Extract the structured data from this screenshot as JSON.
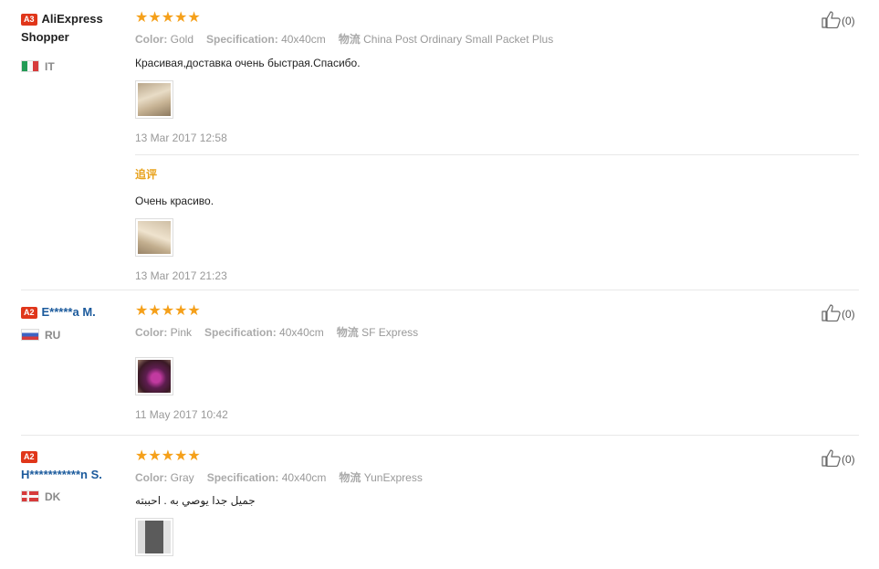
{
  "reviews": [
    {
      "badge": "A3",
      "name": "AliExpress Shopper",
      "country": "IT",
      "attrs": [
        {
          "label": "Color:",
          "value": "Gold"
        },
        {
          "label": "Specification:",
          "value": "40x40cm"
        },
        {
          "label": "物流",
          "value": "China Post Ordinary Small Packet Plus"
        }
      ],
      "text": "Красивая,доставка очень быстрая.Спасибо.",
      "date": "13 Mar 2017 12:58",
      "followup_title": "追评",
      "followup_text": "Очень красиво.",
      "followup_date": "13 Mar 2017 21:23",
      "likes": "(0)"
    },
    {
      "badge": "A2",
      "name": "E*****a M.",
      "country": "RU",
      "attrs": [
        {
          "label": "Color:",
          "value": "Pink"
        },
        {
          "label": "Specification:",
          "value": "40x40cm"
        },
        {
          "label": "物流",
          "value": "SF Express"
        }
      ],
      "date": "11 May 2017 10:42",
      "likes": "(0)"
    },
    {
      "badge": "A2",
      "name": "H***********n S.",
      "country": "DK",
      "attrs": [
        {
          "label": "Color:",
          "value": "Gray"
        },
        {
          "label": "Specification:",
          "value": "40x40cm"
        },
        {
          "label": "物流",
          "value": "YunExpress"
        }
      ],
      "text": "جميل جدا يوصي به . احببته",
      "likes": "(0)"
    }
  ],
  "colors": {
    "star": "#f5a01a",
    "badge": "#e0361a",
    "followup": "#e8a21c",
    "link_name": "#1b5a9c"
  },
  "icons": {
    "star": "star-icon",
    "like": "thumbs-up-icon"
  }
}
